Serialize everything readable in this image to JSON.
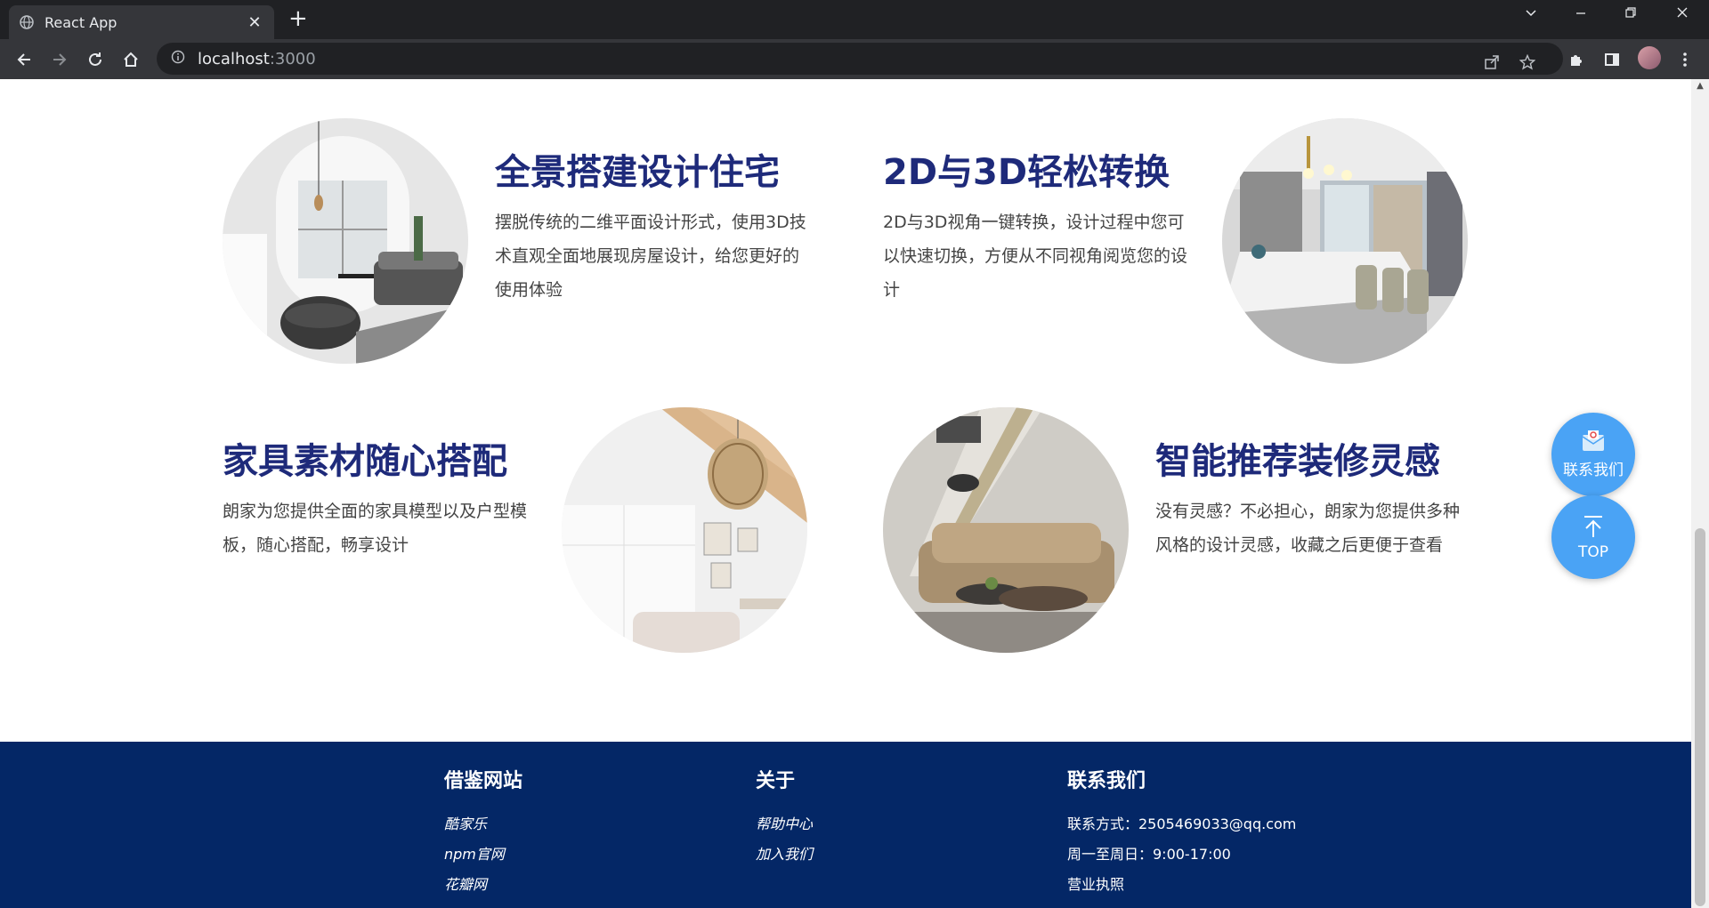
{
  "browser": {
    "tab_title": "React App",
    "tab_close": "✕",
    "new_tab": "+",
    "url_host": "localhost",
    "url_port": ":3000"
  },
  "features": [
    {
      "title": "全景搭建设计住宅",
      "desc": "摆脱传统的二维平面设计形式，使用3D技术直观全面地展现房屋设计，给您更好的使用体验"
    },
    {
      "title": "2D与3D轻松转换",
      "desc": "2D与3D视角一键转换，设计过程中您可以快速切换，方便从不同视角阅览您的设计"
    },
    {
      "title": "家具素材随心搭配",
      "desc": "朗家为您提供全面的家具模型以及户型模板，随心搭配，畅享设计"
    },
    {
      "title": "智能推荐装修灵感",
      "desc": "没有灵感？不必担心，朗家为您提供多种风格的设计灵感，收藏之后更便于查看"
    }
  ],
  "float": {
    "contact_label": "联系我们",
    "top_label": "TOP"
  },
  "footer": {
    "col1": {
      "heading": "借鉴网站",
      "links": [
        "酷家乐",
        "npm官网",
        "花瓣网"
      ]
    },
    "col2": {
      "heading": "关于",
      "links": [
        "帮助中心",
        "加入我们"
      ]
    },
    "col3": {
      "heading": "联系我们",
      "lines": [
        "联系方式：2505469033@qq.com",
        "周一至周日：9:00-17:00",
        "营业执照"
      ]
    }
  },
  "colors": {
    "title": "#1e2a7a",
    "footer_bg": "#042766",
    "float_btn": "#4aa3f5"
  }
}
